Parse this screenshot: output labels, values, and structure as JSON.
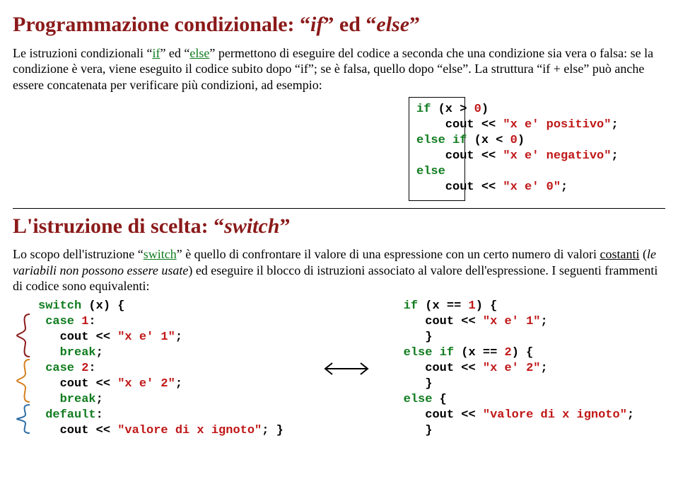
{
  "section1": {
    "title_pre": "Programmazione condizionale: “",
    "title_kw1": "if",
    "title_mid": "” ed “",
    "title_kw2": "else",
    "title_post": "”",
    "para_a_1": "Le istruzioni condizionali “",
    "para_a_if": "if",
    "para_a_2": "” ed “",
    "para_a_else": "else",
    "para_a_3": "” permettono di eseguire del codice a seconda che una condizione sia vera o falsa: se la condizione è vera, viene eseguito il codice subito dopo “if”; se è falsa, quello dopo “else”. La struttura “if + else” può anche essere concatenata per verificare più condizioni, ad esempio:",
    "code": {
      "l1_k": "if",
      "l1_t": " (x > ",
      "l1_n": "0",
      "l1_e": ")",
      "l2_a": "    cout << ",
      "l2_s": "\"x e' positivo\"",
      "l2_e": ";",
      "l3_k1": "else if",
      "l3_t": " (x < ",
      "l3_n": "0",
      "l3_e": ")",
      "l4_a": "    cout << ",
      "l4_s": "\"x e' negativo\"",
      "l4_e": ";",
      "l5_k": "else",
      "l6_a": "    cout << ",
      "l6_s": "\"x e' 0\"",
      "l6_e": ";"
    }
  },
  "section2": {
    "title_pre": "L'istruzione di scelta: “",
    "title_kw": "switch",
    "title_post": "”",
    "para_1": "Lo scopo dell'istruzione “",
    "para_switch": "switch",
    "para_2": "” è quello di confrontare il valore di una espressione con un certo numero di valori ",
    "para_const": "costanti",
    "para_3": " (",
    "para_emph": "le variabili non possono essere usate",
    "para_4": ") ed eseguire il blocco di istruzioni associato al valore dell'espressione. I seguenti frammenti di codice sono equivalenti:",
    "left": {
      "l1_k": "switch",
      "l1_t": " (x) {",
      "l2_k": " case",
      "l2_t": " ",
      "l2_n": "1",
      "l2_e": ":",
      "l3_a": "   cout << ",
      "l3_s": "\"x e' 1\"",
      "l3_e": ";",
      "l4_k": "   break",
      "l4_e": ";",
      "l5_k": " case",
      "l5_t": " ",
      "l5_n": "2",
      "l5_e": ":",
      "l6_a": "   cout << ",
      "l6_s": "\"x e' 2\"",
      "l6_e": ";",
      "l7_k": "   break",
      "l7_e": ";",
      "l8_k": " default",
      "l8_e": ":",
      "l9_a": "   cout << ",
      "l9_s": "\"valore di x ignoto\"",
      "l9_e": "; }"
    },
    "right": {
      "l1_k": "if",
      "l1_t": " (x == ",
      "l1_n": "1",
      "l1_e": ") {",
      "l2_a": "   cout << ",
      "l2_s": "\"x e' 1\"",
      "l2_e": ";",
      "l3": "   }",
      "l4_k": "else if",
      "l4_t": " (x == ",
      "l4_n": "2",
      "l4_e": ") {",
      "l5_a": "   cout << ",
      "l5_s": "\"x e' 2\"",
      "l5_e": ";",
      "l6": "   }",
      "l7_k": "else",
      "l7_e": " {",
      "l8_a": "   cout << ",
      "l8_s": "\"valore di x ignoto\"",
      "l8_e": ";",
      "l9": "   }"
    }
  }
}
